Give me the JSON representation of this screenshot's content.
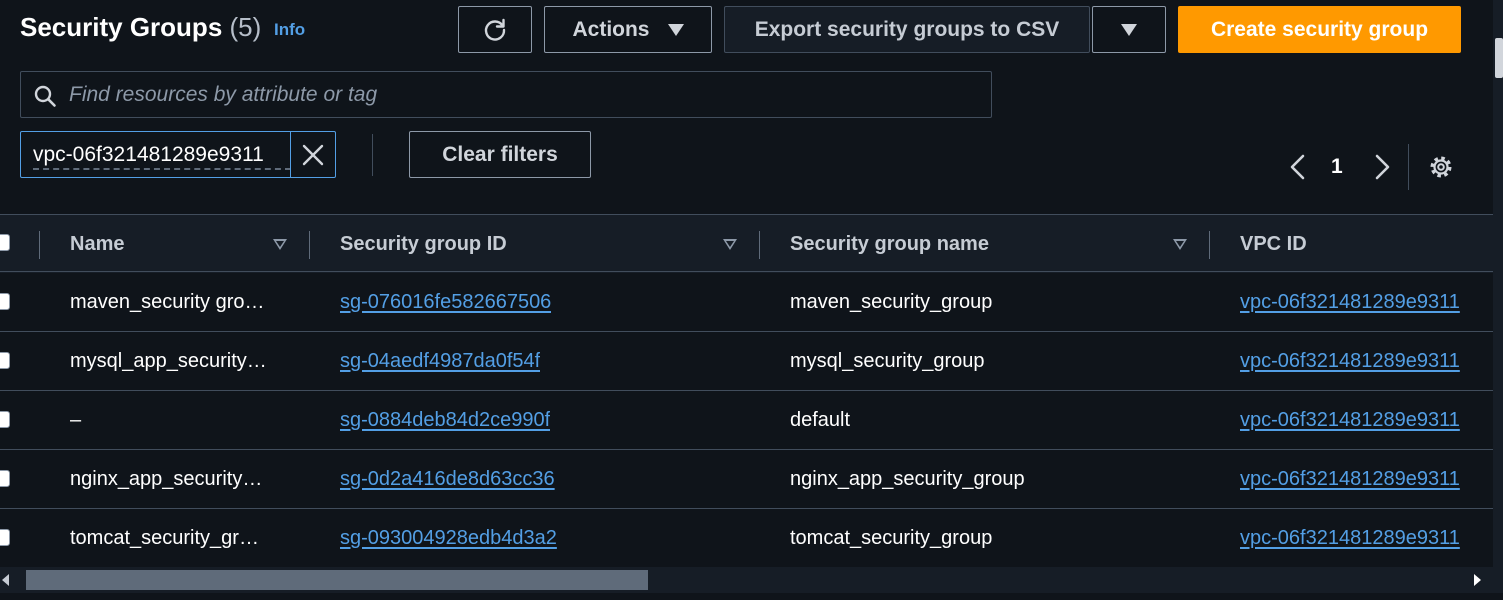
{
  "header": {
    "title": "Security Groups",
    "count": "(5)",
    "info_label": "Info"
  },
  "toolbar": {
    "actions_label": "Actions",
    "export_label": "Export security groups to CSV",
    "create_label": "Create security group",
    "clear_filters_label": "Clear filters"
  },
  "search": {
    "placeholder": "Find resources by attribute or tag",
    "value": ""
  },
  "filter_token": {
    "value": "vpc-06f321481289e9311"
  },
  "pagination": {
    "current_page": "1"
  },
  "table": {
    "columns": [
      "Name",
      "Security group ID",
      "Security group name",
      "VPC ID"
    ],
    "rows": [
      {
        "name": "maven_security gro…",
        "id": "sg-076016fe582667506",
        "group_name": "maven_security_group",
        "vpc": "vpc-06f321481289e9311"
      },
      {
        "name": "mysql_app_security…",
        "id": "sg-04aedf4987da0f54f",
        "group_name": "mysql_security_group",
        "vpc": "vpc-06f321481289e9311"
      },
      {
        "name": "–",
        "id": "sg-0884deb84d2ce990f",
        "group_name": "default",
        "vpc": "vpc-06f321481289e9311"
      },
      {
        "name": "nginx_app_security…",
        "id": "sg-0d2a416de8d63cc36",
        "group_name": "nginx_app_security_group",
        "vpc": "vpc-06f321481289e9311"
      },
      {
        "name": "tomcat_security_gr…",
        "id": "sg-093004928edb4d3a2",
        "group_name": "tomcat_security_group",
        "vpc": "vpc-06f321481289e9311"
      }
    ]
  },
  "colors": {
    "accent": "#ff9900",
    "link": "#539fe5",
    "background": "#0f141a"
  }
}
